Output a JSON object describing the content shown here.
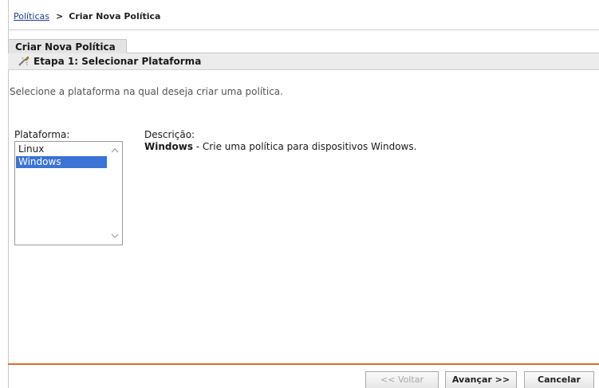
{
  "breadcrumb": {
    "link": "Políticas",
    "separator": ">",
    "current": "Criar Nova Política"
  },
  "wizard": {
    "tab_title": "Criar Nova Política",
    "step_title": "Etapa 1: Selecionar Plataforma",
    "step_icon": "wizard-step-icon"
  },
  "instructions": "Selecione a plataforma na qual deseja criar uma política.",
  "platform": {
    "label": "Plataforma:",
    "options": [
      {
        "label": "Linux",
        "selected": false
      },
      {
        "label": "Windows",
        "selected": true
      }
    ]
  },
  "description": {
    "label": "Descrição:",
    "name": "Windows",
    "text": " - Crie uma política para dispositivos Windows."
  },
  "buttons": {
    "back": "<< Voltar",
    "back_enabled": false,
    "next": "Avançar >>",
    "cancel": "Cancelar"
  },
  "colors": {
    "link": "#1f3e9a",
    "selection": "#3b73d6",
    "accent_rule": "#e06a2c"
  }
}
